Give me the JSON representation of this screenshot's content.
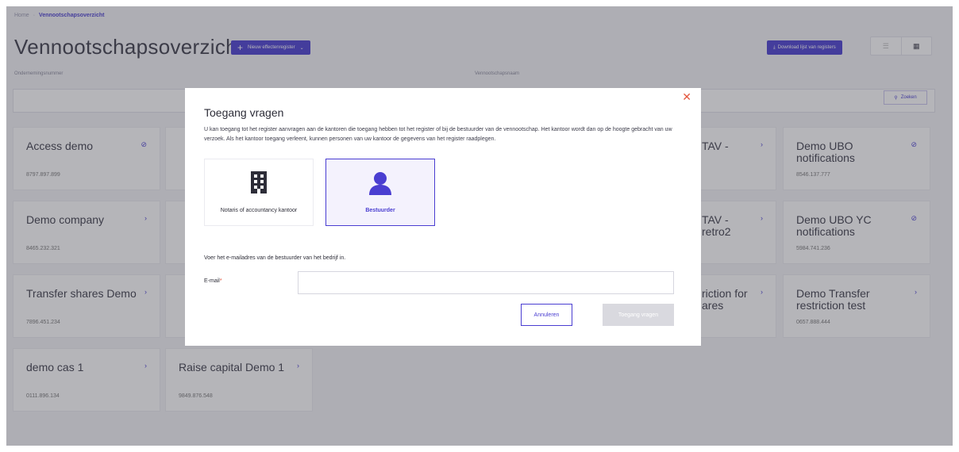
{
  "breadcrumb": {
    "home": "Home",
    "current": "Vennootschapsoverzicht"
  },
  "page": {
    "title": "Vennootschapsoverzicht",
    "new_register_label": "Nieuw effectenregister",
    "download_label": "Download lijst van registers",
    "filter_number_label": "Ondernemingsnummer",
    "filter_name_label": "Vennootschapsnaam",
    "search_label": "Zoeken"
  },
  "cards": [
    {
      "name": "Access demo",
      "number": "8797.897.899",
      "icon": "circle-slash-icon"
    },
    {
      "name": "Demo UBO notifications",
      "number": "8546.137.777",
      "icon": "circle-slash-icon"
    },
    {
      "name": "Demo company",
      "number": "8465.232.321",
      "icon": "chevron-right-icon"
    },
    {
      "name": "Demo UBO YC notifications",
      "number": "5984.741.236",
      "icon": "circle-slash-icon"
    },
    {
      "name": "Transfer shares Demo",
      "number": "7896.451.234",
      "icon": "chevron-right-icon"
    },
    {
      "name": "Demo Transfer restriction test",
      "number": "0657.888.444",
      "icon": "chevron-right-icon"
    },
    {
      "name": "demo cas 1",
      "number": "0111.896.134",
      "icon": "chevron-right-icon"
    },
    {
      "name": "Raise capital Demo 1",
      "number": "9849.876.548",
      "icon": "chevron-right-icon"
    }
  ],
  "partial_cards": [
    {
      "text": "TAV -"
    },
    {
      "text": "TAV -"
    },
    {
      "text": "retro2"
    },
    {
      "text": "riction for"
    },
    {
      "text": "ares"
    }
  ],
  "modal": {
    "title": "Toegang vragen",
    "description": "U kan toegang tot het register aanvragen aan de kantoren die toegang hebben tot het register of bij de bestuurder van de vennootschap. Het kantoor wordt dan op de hoogte gebracht van uw verzoek. Als het kantoor toegang verleent, kunnen personen van uw kantoor de gegevens van het register raadplegen.",
    "options": [
      {
        "label": "Notaris of accountancy kantoor",
        "icon": "building-icon",
        "selected": false
      },
      {
        "label": "Bestuurder",
        "icon": "person-icon",
        "selected": true
      }
    ],
    "helper": "Voer het e-mailadres van de bestuurder van het bedrijf in.",
    "email_label": "E-mail",
    "email_required": "*",
    "email_value": "",
    "cancel_label": "Annuleren",
    "submit_label": "Toegang vragen"
  },
  "colors": {
    "accent": "#4a3ed1",
    "close": "#e4573f",
    "disabled": "#d9d9df"
  }
}
